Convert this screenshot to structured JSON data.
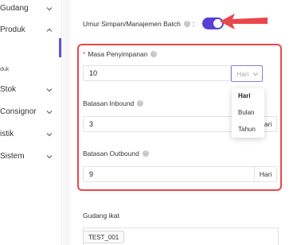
{
  "sidebar": {
    "items": [
      {
        "label": "Gudang",
        "chevron": "down"
      },
      {
        "label": "Produk",
        "chevron": "up"
      },
      {
        "label": "duk",
        "chevron": ""
      },
      {
        "label": "Stok",
        "chevron": "down"
      },
      {
        "label": "Consignor",
        "chevron": "down"
      },
      {
        "label": "istik",
        "chevron": "down"
      },
      {
        "label": "Sistem",
        "chevron": "down"
      }
    ],
    "accent_color": "#6a4fd1"
  },
  "form": {
    "batch_toggle": {
      "label": "Umur Simpan/Manajemen Batch",
      "colon": ":",
      "on": true,
      "color": "#5a3fd6"
    },
    "masa_penyimpanan": {
      "required_mark": "*",
      "label": "Masa Penyimpanan",
      "value": "10",
      "unit_placeholder": "Hari"
    },
    "batasan_inbound": {
      "label": "Batasan Inbound",
      "value": "3",
      "unit": "Hari"
    },
    "batasan_outbound": {
      "label": "Batasan Outbound",
      "value": "9",
      "unit": "Hari"
    },
    "unit_dropdown": {
      "options": [
        "Hari",
        "Bulan",
        "Tahun"
      ],
      "selected": "Hari"
    },
    "gudang_ikat": {
      "label": "Gudang ikat",
      "tag": "TEST_001"
    }
  },
  "annotation_color": "#e8474b"
}
